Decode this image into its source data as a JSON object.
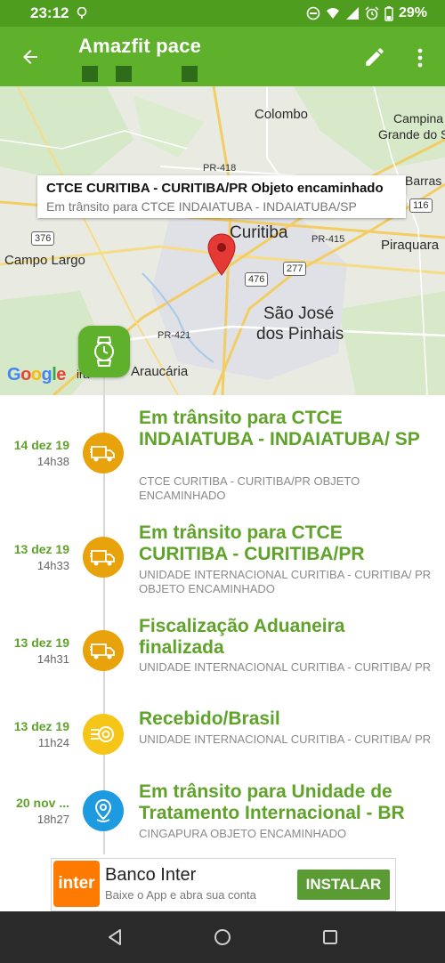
{
  "status_bar": {
    "time": "23:12",
    "battery": "29%",
    "icons": [
      "signal-dot-icon",
      "do-not-disturb-icon",
      "wifi-icon",
      "cell-signal-icon",
      "alarm-icon",
      "battery-icon"
    ]
  },
  "app_bar": {
    "title": "Amazfit pace",
    "icons": [
      "back-arrow-icon",
      "edit-pencil-icon",
      "more-vertical-icon"
    ]
  },
  "map": {
    "labels": {
      "colombo": "Colombo",
      "campina": "Campina",
      "grande_do_sul": "Grande do S",
      "barras": "Barras",
      "curitiba": "Curitiba",
      "piraquara": "Piraquara",
      "campo_largo": "Campo Largo",
      "sao_jose": "São José",
      "dos_pinhais": "dos Pinhais",
      "araucaria": "Araucária",
      "ira": "ira"
    },
    "roads": {
      "pr418": "PR-418",
      "pr415": "PR-415",
      "pr421": "PR-421",
      "r376": "376",
      "r277": "277",
      "r476": "476",
      "r116": "116"
    },
    "infowindow": {
      "line1": "CTCE CURITIBA - CURITIBA/PR Objeto encaminhado",
      "line2": "Em trânsito para CTCE INDAIATUBA - INDAIATUBA/SP"
    },
    "google_logo": "Google"
  },
  "events": [
    {
      "date": "14 dez 19",
      "time": "14h38",
      "title": "Em trânsito para CTCE INDAIATUBA - INDAIATUBA/ SP",
      "description": "CTCE CURITIBA - CURITIBA/PR OBJETO ENCAMINHADO",
      "icon": "truck-icon",
      "color": "#e8a20c"
    },
    {
      "date": "13 dez 19",
      "time": "14h33",
      "title": "Em trânsito para CTCE CURITIBA - CURITIBA/PR",
      "description": "UNIDADE INTERNACIONAL CURITIBA - CURITIBA/ PR OBJETO ENCAMINHADO",
      "icon": "truck-icon",
      "color": "#e8a20c"
    },
    {
      "date": "13 dez 19",
      "time": "14h31",
      "title": "Fiscalização Aduaneira finalizada",
      "description": "UNIDADE INTERNACIONAL CURITIBA - CURITIBA/ PR",
      "icon": "truck-icon",
      "color": "#e8a20c"
    },
    {
      "date": "13 dez 19",
      "time": "11h24",
      "title": "Recebido/Brasil",
      "description": "UNIDADE INTERNACIONAL CURITIBA - CURITIBA/ PR",
      "icon": "received-icon",
      "color": "#f5c518"
    },
    {
      "date": "20 nov ...",
      "time": "18h27",
      "title": "Em trânsito para Unidade de Tratamento Internacional - BR",
      "description": "CINGAPURA OBJETO ENCAMINHADO",
      "icon": "location-pin-icon",
      "color": "#1e9be0"
    }
  ],
  "ad": {
    "logo": "inter",
    "title": "Banco Inter",
    "subtitle": "Baixe o App e abra sua conta",
    "button": "INSTALAR"
  },
  "colors": {
    "status_bar": "#4f9d1f",
    "app_bar": "#5fb02a",
    "accent_green": "#5fa32a",
    "truck_orange": "#e8a20c",
    "received_yellow": "#f5c518",
    "transit_blue": "#1e9be0",
    "ad_button": "#5a9b33",
    "inter_orange": "#ff7a00"
  },
  "nav_bar": {
    "icons": [
      "nav-back-icon",
      "nav-home-icon",
      "nav-recents-icon"
    ]
  }
}
